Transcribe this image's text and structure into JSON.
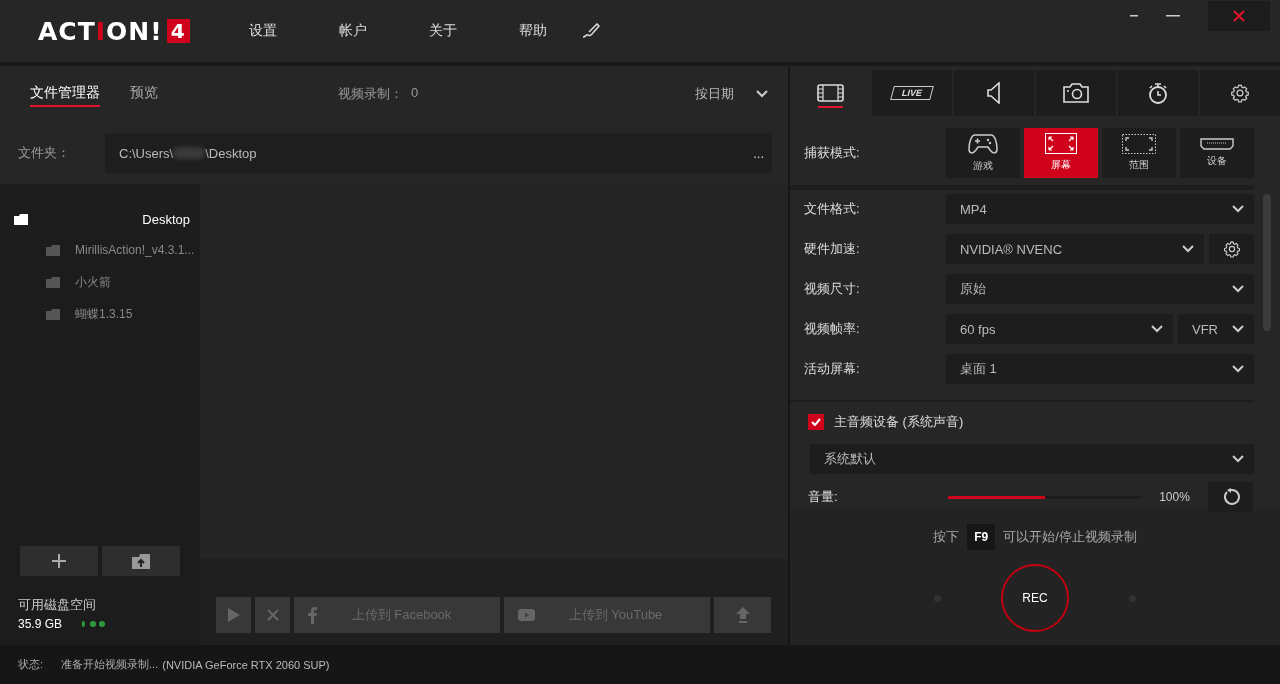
{
  "app": {
    "logo": "ACT",
    "logo_accent": "I",
    "logo_rest": "ON!",
    "logo_badge": "4"
  },
  "menu": [
    {
      "label": "设置"
    },
    {
      "label": "帐户"
    },
    {
      "label": "关于"
    },
    {
      "label": "帮助"
    }
  ],
  "left_tabs": [
    {
      "label": "文件管理器",
      "selected": true
    },
    {
      "label": "预览",
      "selected": false
    }
  ],
  "recordings": {
    "label": "视频录制：",
    "value": "0"
  },
  "sort": {
    "value": "按日期"
  },
  "folder": {
    "label": "文件夹：",
    "path_start": "C:\\Users\\",
    "path_end": "\\Desktop",
    "more": "..."
  },
  "tree": [
    {
      "name": "Desktop",
      "selected": true,
      "children": [
        {
          "name": "MirillisAction!_v4.3.1...",
          "selected": false
        },
        {
          "name": "小火箭",
          "selected": false
        },
        {
          "name": "蝴蝶1.3.15",
          "selected": false
        }
      ]
    }
  ],
  "disk": {
    "label": "可用磁盘空间",
    "value": "35.9 GB"
  },
  "actions": [
    {
      "kind": "play",
      "disabled": true
    },
    {
      "kind": "delete",
      "disabled": true
    },
    {
      "kind": "facebook",
      "label": "上传到 Facebook",
      "disabled": true
    },
    {
      "kind": "youtube",
      "label": "上传到 YouTube",
      "disabled": true
    },
    {
      "kind": "upload",
      "disabled": true
    }
  ],
  "right_tabs": [
    {
      "kind": "video",
      "selected": true
    },
    {
      "kind": "live",
      "label": "LIVE",
      "selected": false
    },
    {
      "kind": "audio",
      "selected": false
    },
    {
      "kind": "camera",
      "selected": false
    },
    {
      "kind": "timer",
      "selected": false
    },
    {
      "kind": "settings",
      "selected": false
    }
  ],
  "capture_mode": {
    "label": "捕获模式:",
    "options": [
      {
        "kind": "game",
        "label": "游戏",
        "selected": false
      },
      {
        "kind": "screen",
        "label": "屏幕",
        "selected": true
      },
      {
        "kind": "area",
        "label": "范围",
        "selected": false
      },
      {
        "kind": "device",
        "label": "设备",
        "selected": false
      }
    ]
  },
  "settings": [
    {
      "kind": "select",
      "label": "文件格式:",
      "value": "MP4"
    },
    {
      "kind": "select-gear",
      "label": "硬件加速:",
      "value": "NVIDIA® NVENC"
    },
    {
      "kind": "select",
      "label": "视频尺寸:",
      "value": "原始"
    },
    {
      "kind": "select-pair",
      "label": "视频帧率:",
      "value": "60 fps",
      "extra": "VFR"
    },
    {
      "kind": "select",
      "label": "活动屏幕:",
      "value": "桌面 1"
    }
  ],
  "audio": {
    "checked": true,
    "label": "主音频设备 (系统声音)",
    "device": "系统默认",
    "volume_label": "音量:",
    "level": 0.5,
    "reading": "100%"
  },
  "hotkey": {
    "before": "按下",
    "key": "F9",
    "after": "可以开始/停止视频录制"
  },
  "rec": {
    "label": "REC"
  },
  "status": {
    "label": "状态:",
    "text": "准备开始视频录制...",
    "gpu": "(NVIDIA GeForce RTX 2060 SUP)"
  }
}
